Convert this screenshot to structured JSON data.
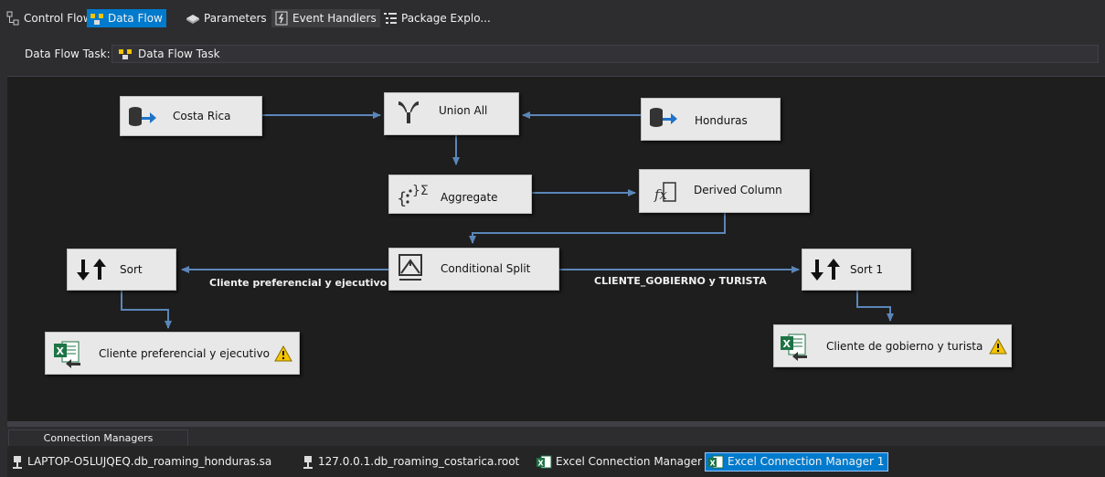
{
  "tabs": [
    {
      "label": "Control Flow",
      "icon": "control-flow-icon",
      "state": "normal"
    },
    {
      "label": "Data Flow",
      "icon": "data-flow-icon",
      "state": "active"
    },
    {
      "label": "Parameters",
      "icon": "parameters-icon",
      "state": "normal"
    },
    {
      "label": "Event Handlers",
      "icon": "event-handlers-icon",
      "state": "hover"
    },
    {
      "label": "Package Explo...",
      "icon": "package-explorer-icon",
      "state": "normal"
    }
  ],
  "task_bar": {
    "label": "Data Flow Task:",
    "selected": "Data Flow Task"
  },
  "nodes": {
    "costa_rica": "Costa Rica",
    "union_all": "Union All",
    "honduras": "Honduras",
    "aggregate": "Aggregate",
    "derived_column": "Derived Column",
    "conditional_split": "Conditional Split",
    "sort": "Sort",
    "sort1": "Sort 1",
    "excel_dest1": "Cliente preferencial y ejecutivo",
    "excel_dest2": "Cliente de gobierno y turista"
  },
  "path_labels": {
    "left": "Cliente preferencial y ejecutivo",
    "right": "CLIENTE_GOBIERNO y TURISTA"
  },
  "connection_managers": {
    "tab_label": "Connection Managers",
    "items": [
      {
        "label": "LAPTOP-O5LUJQEQ.db_roaming_honduras.sa",
        "icon": "oledb-connection-icon",
        "selected": false
      },
      {
        "label": "127.0.0.1.db_roaming_costarica.root",
        "icon": "oledb-connection-icon",
        "selected": false
      },
      {
        "label": "Excel Connection Manager",
        "icon": "excel-connection-icon",
        "selected": false
      },
      {
        "label": "Excel Connection Manager 1",
        "icon": "excel-connection-icon",
        "selected": true
      }
    ]
  },
  "colors": {
    "accent": "#007acc",
    "canvas": "#1e1e1e",
    "connector": "#5b86b8",
    "warning": "#f5c400",
    "excel_green": "#1d7344"
  }
}
